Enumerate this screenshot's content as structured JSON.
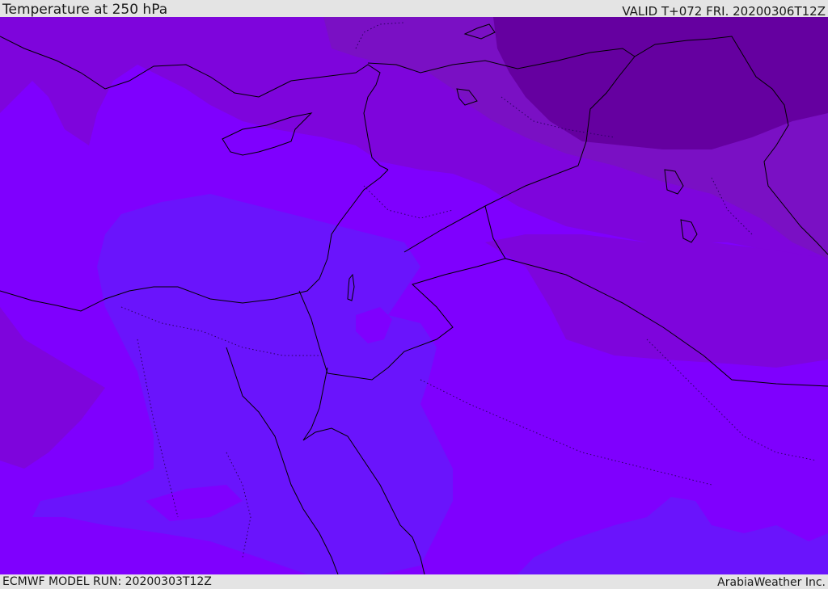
{
  "header": {
    "title": "Temperature at 250 hPa",
    "valid": "VALID T+072 FRI. 20200306T12Z"
  },
  "footer": {
    "model_run": "ECMWF MODEL RUN: 20200303T12Z",
    "credit": "ArabiaWeather Inc."
  },
  "colors": {
    "base_violet": "#7f00fe",
    "cold_blue_violet": "#6a14fc",
    "mid_purple": "#7e05dc",
    "warm_purple": "#7a10c4",
    "dark_purple": "#6500a0",
    "coastline": "#000000",
    "ui_gray": "#e4e4e4"
  },
  "map": {
    "region": "Eastern Mediterranean and Middle East",
    "field": "temperature",
    "layers": [
      "temperature-shading",
      "coastlines",
      "country-borders",
      "internal-boundaries"
    ]
  }
}
